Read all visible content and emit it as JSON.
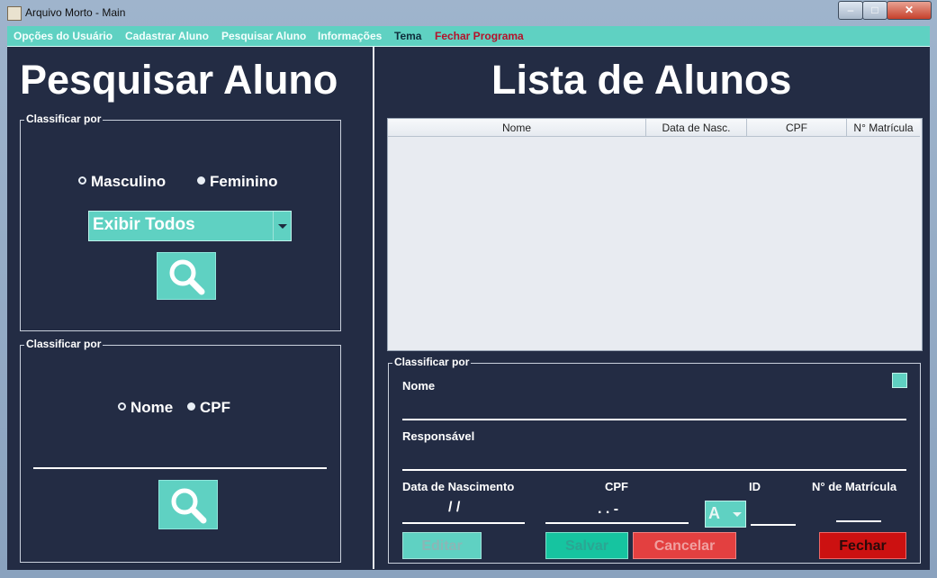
{
  "window": {
    "title": "Arquivo Morto - Main",
    "close_glyph": "✕",
    "minimize_glyph": "–",
    "maximize_glyph": "□"
  },
  "menu": {
    "items": [
      {
        "label": "Opções do Usuário"
      },
      {
        "label": "Cadastrar Aluno"
      },
      {
        "label": "Pesquisar Aluno"
      },
      {
        "label": "Informações"
      },
      {
        "label": "Tema"
      },
      {
        "label": "Fechar Programa"
      }
    ]
  },
  "left": {
    "title": "Pesquisar Aluno",
    "group1": {
      "label": "Classificar por",
      "radio_masculino": "Masculino",
      "radio_feminino": "Feminino",
      "select_value": "Exibir Todos"
    },
    "group2": {
      "label": "Classificar por",
      "radio_nome": "Nome",
      "radio_cpf": "CPF",
      "search_value": ""
    }
  },
  "right": {
    "title": "Lista de Alunos",
    "table": {
      "columns": [
        "Nome",
        "Data de Nasc.",
        "CPF",
        "N° Matrícula"
      ],
      "rows": []
    },
    "form": {
      "label": "Classificar por",
      "nome_label": "Nome",
      "responsavel_label": "Responsável",
      "nascimento_label": "Data de Nascimento",
      "nascimento_value": "/ /",
      "cpf_label": "CPF",
      "cpf_value": ". . -",
      "id_label": "ID",
      "id_select_value": "A",
      "matricula_label": "N° de Matrícula",
      "buttons": {
        "editar": "Editar",
        "salvar": "Salvar",
        "cancelar": "Cancelar",
        "fechar": "Fechar"
      }
    }
  },
  "colors": {
    "accent": "#5fd1c2",
    "background": "#232c44",
    "cancel": "#e34040",
    "close": "#cc1111",
    "menu_tema": "#0f2e3c",
    "menu_fechar": "#b5122b"
  }
}
